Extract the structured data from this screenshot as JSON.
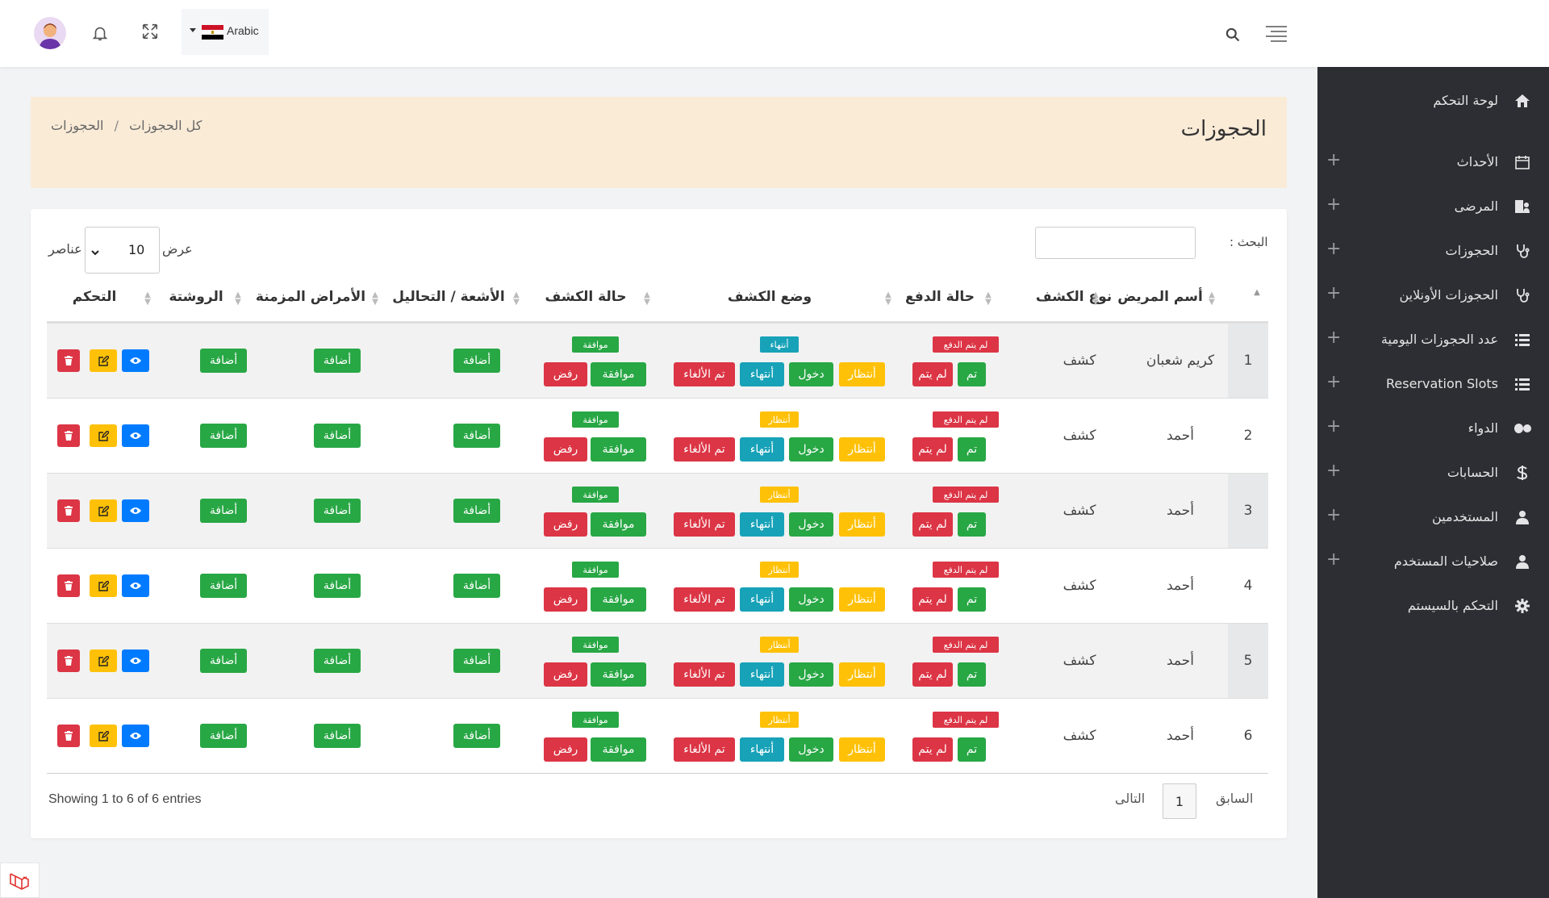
{
  "topbar": {
    "language": "Arabic",
    "search_icon": "search-icon",
    "menu_icon": "menu-lines-icon"
  },
  "sidebar": {
    "items": [
      {
        "label": "لوحة التحكم",
        "icon": "home-icon",
        "has_plus": false
      },
      {
        "label": "الأحداث",
        "icon": "calendar-icon",
        "has_plus": true
      },
      {
        "label": "المرضى",
        "icon": "patients-icon",
        "has_plus": true
      },
      {
        "label": "الحجوزات",
        "icon": "stethoscope-icon",
        "has_plus": true
      },
      {
        "label": "الحجوزات الأونلاين",
        "icon": "stethoscope-icon",
        "has_plus": true
      },
      {
        "label": "عدد الحجوزات اليومية",
        "icon": "list-icon",
        "has_plus": true
      },
      {
        "label": "Reservation Slots",
        "icon": "list-icon",
        "has_plus": true
      },
      {
        "label": "الدواء",
        "icon": "pills-icon",
        "has_plus": true
      },
      {
        "label": "الحسابات",
        "icon": "dollar-icon",
        "has_plus": true
      },
      {
        "label": "المستخدمين",
        "icon": "user-icon",
        "has_plus": true
      },
      {
        "label": "صلاحيات المستخدم",
        "icon": "user-icon",
        "has_plus": true
      },
      {
        "label": "التحكم بالسيستم",
        "icon": "gear-icon",
        "has_plus": false
      }
    ]
  },
  "page": {
    "title": "الحجوزات",
    "breadcrumb_root": "كل الحجوزات",
    "breadcrumb_sep": "/",
    "breadcrumb_current": "الحجوزات"
  },
  "table_controls": {
    "search_label": "البحث :",
    "search_value": "",
    "show_label": "عرض",
    "show_value": "10",
    "entries_label": "عناصر"
  },
  "table": {
    "headers": {
      "name": "أسم المريض",
      "type": "نوع الكشف",
      "payment": "حالة الدفع",
      "visit_status": "وضع الكشف",
      "exam_state": "حالة الكشف",
      "radiology": "الأشعة / التحاليل",
      "chronic": "الأمراض المزمنة",
      "prescription": "الروشتة",
      "control": "التحكم"
    },
    "rows": [
      {
        "index": "1",
        "name": "كريم شعبان",
        "type": "كشف",
        "payment_tag": "لم يتم الدفع",
        "visit_tag": "أنتهاء",
        "visit_tag_color": "teal",
        "exam_tag": "موافقة"
      },
      {
        "index": "2",
        "name": "أحمد",
        "type": "كشف",
        "payment_tag": "لم يتم الدفع",
        "visit_tag": "أنتظار",
        "visit_tag_color": "yellow",
        "exam_tag": "موافقة"
      },
      {
        "index": "3",
        "name": "أحمد",
        "type": "كشف",
        "payment_tag": "لم يتم الدفع",
        "visit_tag": "أنتظار",
        "visit_tag_color": "yellow",
        "exam_tag": "موافقة"
      },
      {
        "index": "4",
        "name": "أحمد",
        "type": "كشف",
        "payment_tag": "لم يتم الدفع",
        "visit_tag": "أنتظار",
        "visit_tag_color": "yellow",
        "exam_tag": "موافقة"
      },
      {
        "index": "5",
        "name": "أحمد",
        "type": "كشف",
        "payment_tag": "لم يتم الدفع",
        "visit_tag": "أنتظار",
        "visit_tag_color": "yellow",
        "exam_tag": "موافقة"
      },
      {
        "index": "6",
        "name": "أحمد",
        "type": "كشف",
        "payment_tag": "لم يتم الدفع",
        "visit_tag": "أنتظار",
        "visit_tag_color": "yellow",
        "exam_tag": "موافقة"
      }
    ],
    "buttons": {
      "paid": "تم",
      "not_paid": "لم يتم",
      "wait": "أنتظار",
      "enter": "دخول",
      "finish": "أنتهاء",
      "cancelled": "تم الألغاء",
      "approve": "موافقة",
      "reject": "رفض",
      "add": "أضافة"
    }
  },
  "footer": {
    "info": "Showing 1 to 6 of 6 entries",
    "prev": "السابق",
    "page": "1",
    "next": "التالى"
  },
  "colors": {
    "green": "#28a745",
    "yellow": "#ffc107",
    "red": "#dc3545",
    "teal": "#17a2b8",
    "blue": "#007bff",
    "sidebar": "#2d2e33",
    "breadcrumb_bg": "#faebd7"
  }
}
